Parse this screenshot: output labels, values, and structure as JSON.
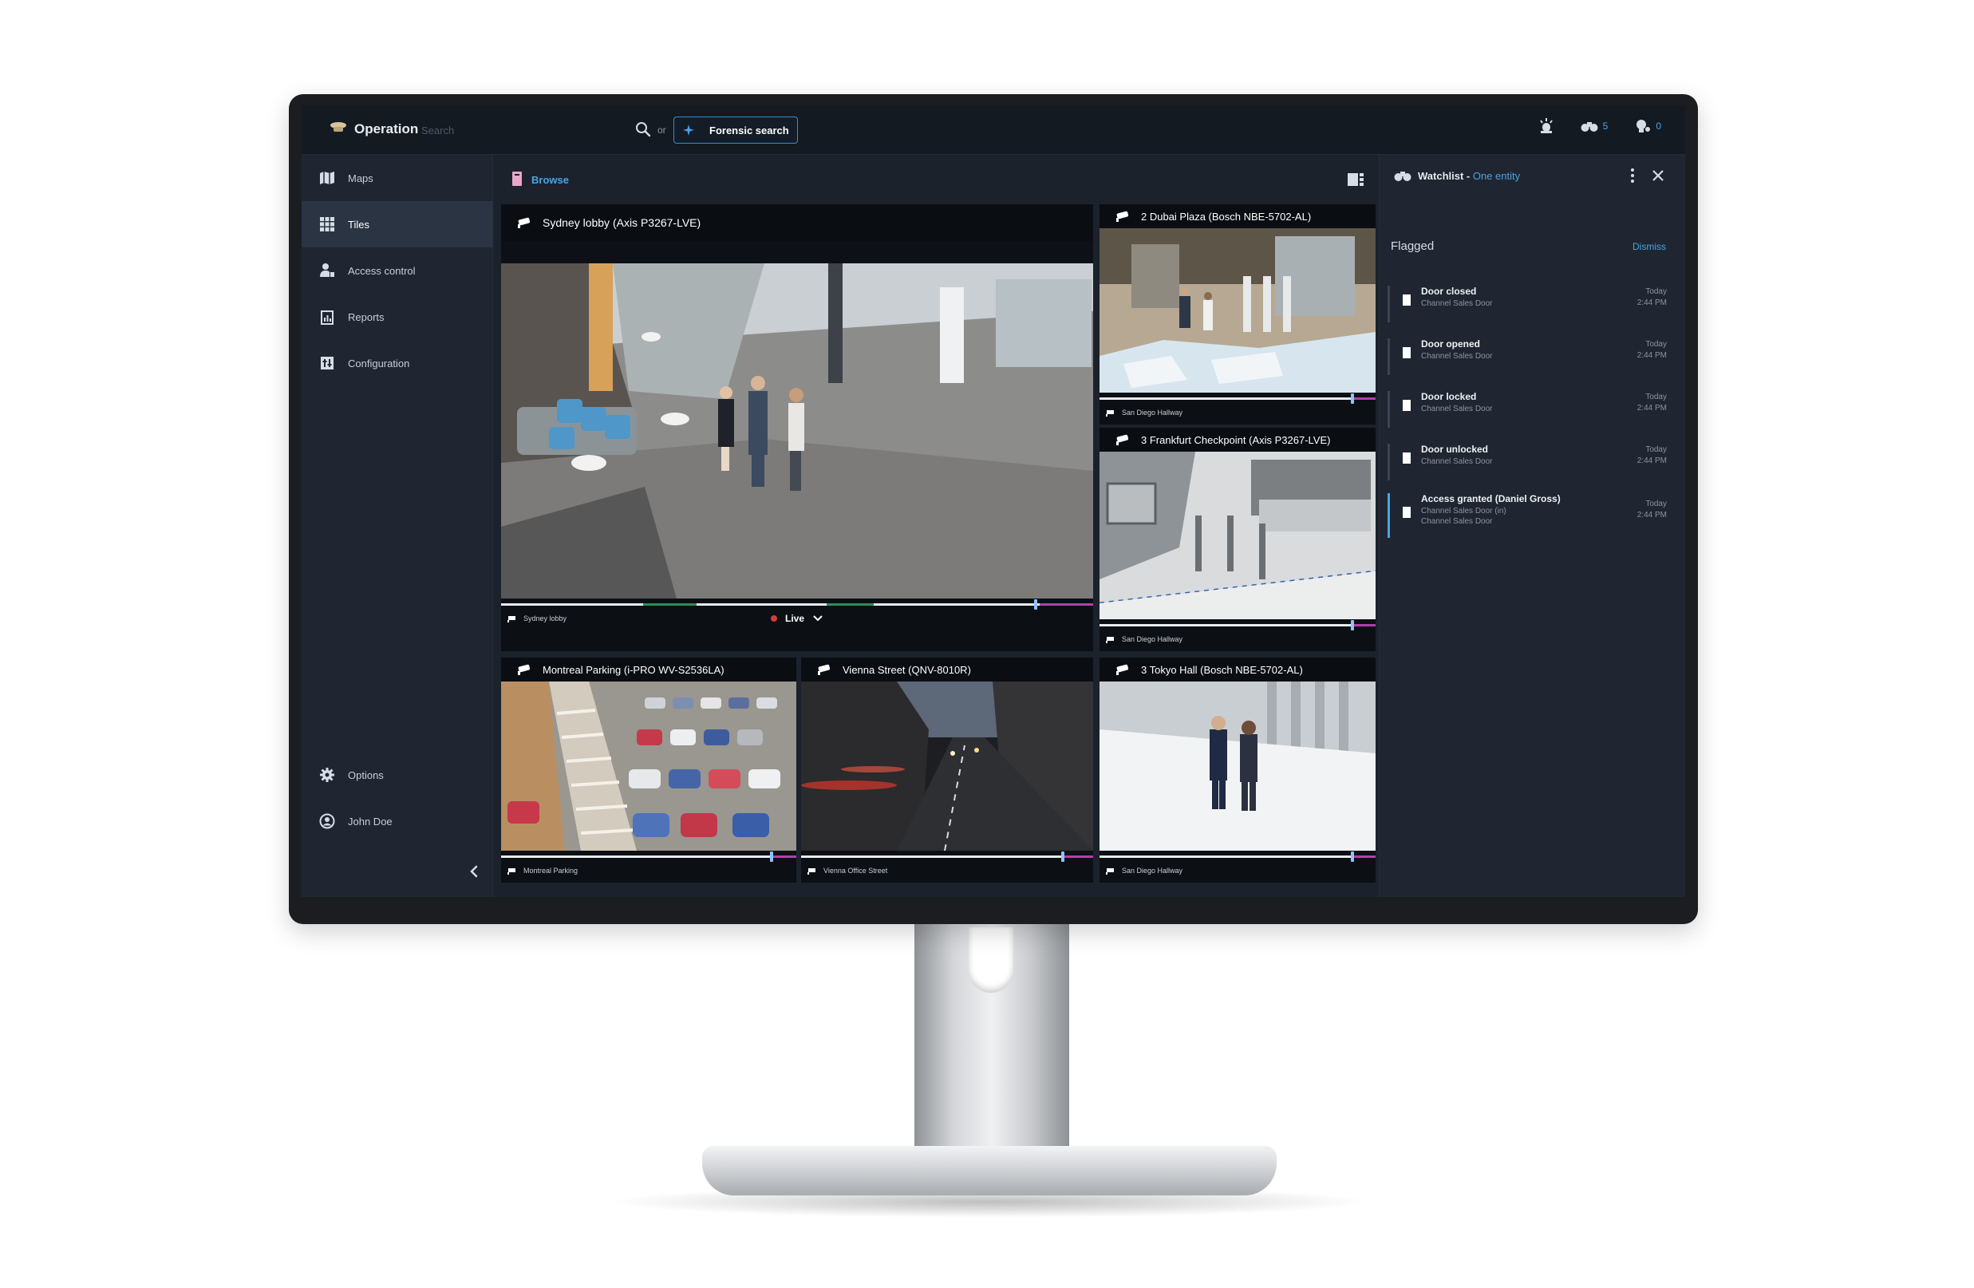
{
  "topbar": {
    "app_title": "Operation",
    "search_placeholder": "Search",
    "or_label": "or",
    "forensic_label": "Forensic search",
    "watch_count": "5",
    "alert_count": "0"
  },
  "sidebar": {
    "items": [
      {
        "label": "Maps",
        "icon": "map-icon"
      },
      {
        "label": "Tiles",
        "icon": "grid-icon"
      },
      {
        "label": "Access control",
        "icon": "access-control-icon"
      },
      {
        "label": "Reports",
        "icon": "reports-icon"
      },
      {
        "label": "Configuration",
        "icon": "configuration-icon"
      }
    ],
    "bottom": [
      {
        "label": "Options",
        "icon": "gear-icon"
      },
      {
        "label": "John Doe",
        "icon": "user-icon"
      }
    ]
  },
  "browse": {
    "label": "Browse"
  },
  "tiles": [
    {
      "title": "Sydney lobby (Axis P3267-LVE)",
      "feed": "Sydney lobby",
      "live": "Live",
      "progress": 0.9
    },
    {
      "title": "2 Dubai Plaza (Bosch NBE-5702-AL)",
      "feed": "San Diego Hallway",
      "progress": 0.92
    },
    {
      "title": "3 Frankfurt Checkpoint (Axis P3267-LVE)",
      "feed": "San Diego Hallway",
      "progress": 0.92
    },
    {
      "title": "Montreal Parking (i-PRO WV-S2536LA)",
      "feed": "Montreal Parking",
      "progress": 0.92
    },
    {
      "title": "Vienna Street (QNV-8010R)",
      "feed": "Vienna Office Street",
      "progress": 0.9
    },
    {
      "title": "3 Tokyo Hall (Bosch NBE-5702-AL)",
      "feed": "San Diego Hallway",
      "progress": 0.92
    }
  ],
  "watchlist": {
    "title": "Watchlist -",
    "subtitle": "One entity",
    "section": "Flagged",
    "dismiss": "Dismiss",
    "events": [
      {
        "title": "Door closed",
        "sub": "Channel Sales Door",
        "day": "Today",
        "time": "2:44 PM"
      },
      {
        "title": "Door opened",
        "sub": "Channel Sales Door",
        "day": "Today",
        "time": "2:44 PM"
      },
      {
        "title": "Door locked",
        "sub": "Channel Sales Door",
        "day": "Today",
        "time": "2:44 PM"
      },
      {
        "title": "Door unlocked",
        "sub": "Channel Sales Door",
        "day": "Today",
        "time": "2:44 PM"
      },
      {
        "title": "Access granted (Daniel Gross)",
        "sub": "Channel Sales Door (in)",
        "sub2": "Channel Sales Door",
        "day": "Today",
        "time": "2:44 PM"
      }
    ]
  },
  "colors": {
    "accent": "#4aa3e3",
    "background": "#1b222c",
    "panel": "#1f2631",
    "timeline_recorded": "#b33fa8",
    "timeline_motion": "#2f8c5a"
  }
}
